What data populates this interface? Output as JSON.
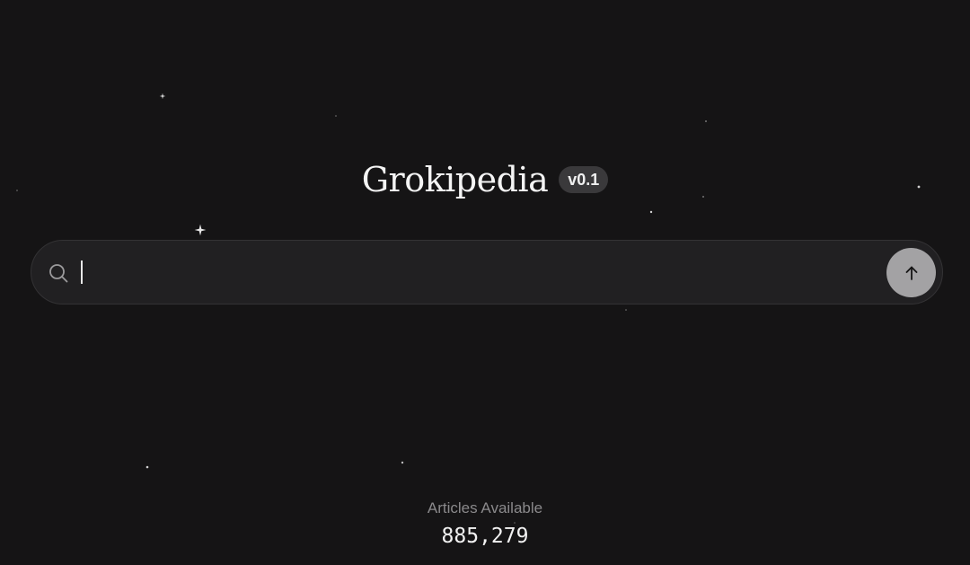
{
  "header": {
    "title": "Grokipedia",
    "version_badge": "v0.1"
  },
  "search": {
    "value": "",
    "placeholder": "",
    "icon": "search-icon",
    "submit_icon": "arrow-up-icon"
  },
  "stats": {
    "label": "Articles Available",
    "count": "885,279"
  },
  "colors": {
    "background": "#151415",
    "search_bar": "#212022",
    "submit_button": "#a3a2a4",
    "badge": "#3a393b"
  }
}
